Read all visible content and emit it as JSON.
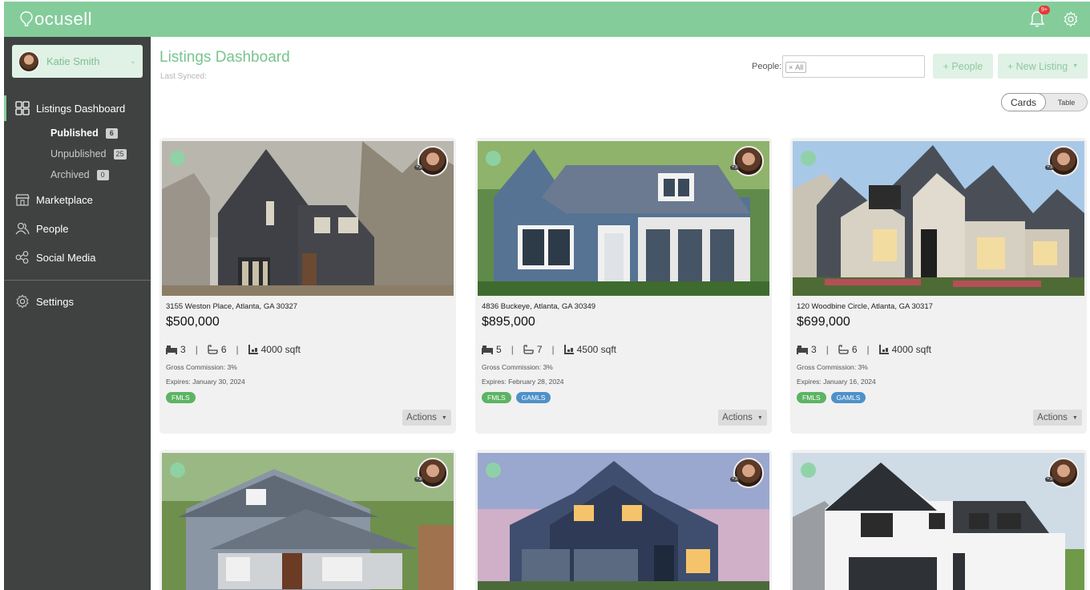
{
  "app": {
    "logo_text": "ocusell",
    "brand_color": "#85cc9b",
    "notification_badge": "9+"
  },
  "sidebar": {
    "user_name": "Katie Smith",
    "nav": [
      {
        "label": "Listings Dashboard",
        "icon": "grid-icon",
        "active": true
      },
      {
        "label": "Marketplace",
        "icon": "storefront-icon"
      },
      {
        "label": "People",
        "icon": "people-icon"
      },
      {
        "label": "Social Media",
        "icon": "share-icon"
      }
    ],
    "listings_sub": [
      {
        "label": "Published",
        "count": "6",
        "active": true
      },
      {
        "label": "Unpublished",
        "count": "25"
      },
      {
        "label": "Archived",
        "count": "0"
      }
    ],
    "settings_label": "Settings"
  },
  "header": {
    "title": "Listings Dashboard",
    "last_synced": "Last Synced:",
    "people_label": "People:",
    "people_filter_tag": "All",
    "add_people_label": "+ People",
    "new_listing_label": "+ New Listing",
    "view_toggle": {
      "cards": "Cards",
      "table": "Table",
      "selected": "Cards"
    }
  },
  "listings": [
    {
      "address": "3155 Weston Place, Atlanta, GA 30327",
      "price": "$500,000",
      "beds": "3",
      "baths": "6",
      "sqft": "4000 sqft",
      "commission": "Gross Commission: 3%",
      "expires": "Expires: January 30, 2024",
      "tags": [
        "FMLS"
      ],
      "actions": "Actions",
      "agent_extra": "+3"
    },
    {
      "address": "4836 Buckeye, Atlanta, GA 30349",
      "price": "$895,000",
      "beds": "5",
      "baths": "7",
      "sqft": "4500 sqft",
      "commission": "Gross Commission: 3%",
      "expires": "Expires: February 28, 2024",
      "tags": [
        "FMLS",
        "GAMLS"
      ],
      "actions": "Actions",
      "agent_extra": "+3"
    },
    {
      "address": "120 Woodbine Circle, Atlanta, GA 30317",
      "price": "$699,000",
      "beds": "3",
      "baths": "6",
      "sqft": "4000 sqft",
      "commission": "Gross Commission: 3%",
      "expires": "Expires: January 16, 2024",
      "tags": [
        "FMLS",
        "GAMLS"
      ],
      "actions": "Actions",
      "agent_extra": "+3"
    },
    {
      "agent_extra": "+3"
    },
    {
      "agent_extra": "+3"
    },
    {
      "agent_extra": "+3"
    }
  ]
}
